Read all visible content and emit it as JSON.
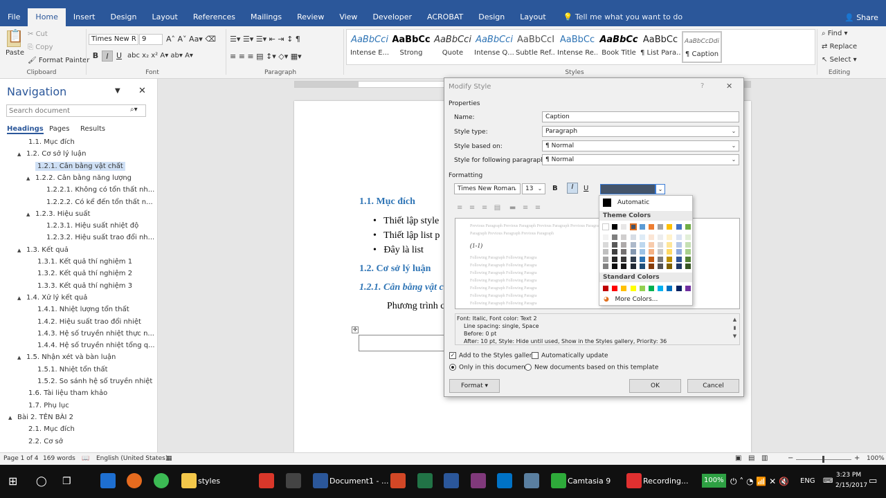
{
  "tabs": [
    "File",
    "Home",
    "Insert",
    "Design",
    "Layout",
    "References",
    "Mailings",
    "Review",
    "View",
    "Developer",
    "ACROBAT",
    "Design",
    "Layout"
  ],
  "tellme": "Tell me what you want to do",
  "share": "Share",
  "clipboard": {
    "paste": "Paste",
    "cut": "Cut",
    "copy": "Copy",
    "format_painter": "Format Painter",
    "label": "Clipboard"
  },
  "font": {
    "name": "Times New R",
    "size": "9",
    "label": "Font"
  },
  "paragraph": {
    "label": "Paragraph"
  },
  "styles": {
    "label": "Styles",
    "items": [
      {
        "preview": "AaBbCci",
        "name": "Intense E..."
      },
      {
        "preview": "AaBbCc",
        "name": "Strong"
      },
      {
        "preview": "AaBbCci",
        "name": "Quote"
      },
      {
        "preview": "AaBbCci",
        "name": "Intense Q..."
      },
      {
        "preview": "AaBbCcI",
        "name": "Subtle Ref..."
      },
      {
        "preview": "AaBbCc",
        "name": "Intense Re..."
      },
      {
        "preview": "AaBbCc",
        "name": "Book Title"
      },
      {
        "preview": "AaBbCc",
        "name": "¶ List Para..."
      },
      {
        "preview": "AaBbCcDdi",
        "name": "¶ Caption"
      }
    ]
  },
  "editing": {
    "find": "Find",
    "replace": "Replace",
    "select": "Select",
    "label": "Editing"
  },
  "nav": {
    "title": "Navigation",
    "search_placeholder": "Search document",
    "tabs": [
      "Headings",
      "Pages",
      "Results"
    ],
    "items": [
      {
        "text": "1.1. Mục đích",
        "lvl": 1,
        "tri": ""
      },
      {
        "text": "1.2. Cơ sở lý luận",
        "lvl": 1,
        "tri": "▲"
      },
      {
        "text": "1.2.1. Cân bằng vật chất",
        "lvl": 2,
        "tri": "",
        "sel": true
      },
      {
        "text": "1.2.2. Cân bằng năng lượng",
        "lvl": 2,
        "tri": "▲"
      },
      {
        "text": "1.2.2.1. Không có tổn thất nh...",
        "lvl": 3,
        "tri": ""
      },
      {
        "text": "1.2.2.2. Có kể đến tổn thất n...",
        "lvl": 3,
        "tri": ""
      },
      {
        "text": "1.2.3. Hiệu suất",
        "lvl": 2,
        "tri": "▲"
      },
      {
        "text": "1.2.3.1. Hiệu suất nhiệt độ",
        "lvl": 3,
        "tri": ""
      },
      {
        "text": "1.2.3.2. Hiệu suất trao đổi nh...",
        "lvl": 3,
        "tri": ""
      },
      {
        "text": "1.3. Kết quả",
        "lvl": 1,
        "tri": "▲"
      },
      {
        "text": "1.3.1. Kết quả thí nghiệm 1",
        "lvl": 2,
        "tri": ""
      },
      {
        "text": "1.3.2. Kết quả thí nghiệm 2",
        "lvl": 2,
        "tri": ""
      },
      {
        "text": "1.3.3. Kết quả thí nghiệm 3",
        "lvl": 2,
        "tri": ""
      },
      {
        "text": "1.4. Xử lý kết quả",
        "lvl": 1,
        "tri": "▲"
      },
      {
        "text": "1.4.1. Nhiệt lượng tổn thất",
        "lvl": 2,
        "tri": ""
      },
      {
        "text": "1.4.2. Hiệu suất trao đổi nhiệt",
        "lvl": 2,
        "tri": ""
      },
      {
        "text": "1.4.3. Hệ số truyền nhiệt thực n...",
        "lvl": 2,
        "tri": ""
      },
      {
        "text": "1.4.4. Hệ số truyền nhiệt tổng q...",
        "lvl": 2,
        "tri": ""
      },
      {
        "text": "1.5. Nhận xét và bàn luận",
        "lvl": 1,
        "tri": "▲"
      },
      {
        "text": "1.5.1. Nhiệt tổn thất",
        "lvl": 2,
        "tri": ""
      },
      {
        "text": "1.5.2. So sánh hệ số truyền nhiệt",
        "lvl": 2,
        "tri": ""
      },
      {
        "text": "1.6. Tài liệu tham khảo",
        "lvl": 1,
        "tri": ""
      },
      {
        "text": "1.7. Phụ lục",
        "lvl": 1,
        "tri": ""
      },
      {
        "text": "Bài 2. TÊN BÀI 2",
        "lvl": 0,
        "tri": "▲"
      },
      {
        "text": "2.1. Mục đích",
        "lvl": 1,
        "tri": ""
      },
      {
        "text": "2.2. Cơ sở",
        "lvl": 1,
        "tri": ""
      }
    ]
  },
  "doc": {
    "h1": "1.1. Mục đích",
    "bullets": [
      "Thiết lập style",
      "Thiết lập list p",
      "Đây là list"
    ],
    "h2": "1.2. Cơ sở lý luận",
    "h3": "1.2.1. Cân bằng vật c",
    "body": "Phương trình c"
  },
  "dialog": {
    "title": "Modify Style",
    "help": "?",
    "close": "✕",
    "properties_label": "Properties",
    "name_label": "Name:",
    "name_value": "Caption",
    "type_label": "Style type:",
    "type_value": "Paragraph",
    "based_label": "Style based on:",
    "based_value": "¶ Normal",
    "following_label": "Style for following paragraph:",
    "following_value": "¶ Normal",
    "formatting_label": "Formatting",
    "font_value": "Times New Roman",
    "size_value": "13",
    "preview_prev": "Previous Paragraph Previous Paragraph Previous Paragraph Previous Paragraph Previous Paragraph Previous Paragraph Previous Paragraph Previous Paragraph Previous Paragraph",
    "preview_sample": "(1-1)",
    "preview_follow": "Following Paragraph Following Paragra",
    "desc_line1": "Font: Italic, Font color: Text 2",
    "desc_line2": "Line spacing:  single, Space",
    "desc_line3": "Before:  0 pt",
    "desc_line4": "After:  10 pt, Style: Hide until used, Show in the Styles gallery, Priority: 36",
    "add_gallery": "Add to the Styles gallery",
    "auto_update": "Automatically update",
    "only_doc": "Only in this document",
    "new_docs": "New documents based on this template",
    "format_btn": "Format ▾",
    "ok": "OK",
    "cancel": "Cancel"
  },
  "palette": {
    "automatic": "Automatic",
    "theme_label": "Theme Colors",
    "standard_label": "Standard Colors",
    "more": "More Colors...",
    "theme_top": [
      "#ffffff",
      "#000000",
      "#e7e6e6",
      "#44546a",
      "#5b9bd5",
      "#ed7d31",
      "#a5a5a5",
      "#ffc000",
      "#4472c4",
      "#70ad47"
    ],
    "theme_cols": [
      [
        "#f2f2f2",
        "#d9d9d9",
        "#bfbfbf",
        "#a6a6a6",
        "#808080"
      ],
      [
        "#7f7f7f",
        "#595959",
        "#404040",
        "#262626",
        "#0d0d0d"
      ],
      [
        "#d0cece",
        "#aeaaaa",
        "#757171",
        "#3a3838",
        "#171616"
      ],
      [
        "#d6dce4",
        "#adb9ca",
        "#8497b0",
        "#333f4f",
        "#222a35"
      ],
      [
        "#deebf6",
        "#bdd7ee",
        "#9dc3e6",
        "#2e75b5",
        "#1f4e79"
      ],
      [
        "#fbe5d5",
        "#f7cbac",
        "#f4b183",
        "#c55a11",
        "#843c0b"
      ],
      [
        "#ededed",
        "#dbdbdb",
        "#c9c9c9",
        "#7b7b7b",
        "#525252"
      ],
      [
        "#fff2cc",
        "#fee599",
        "#ffd965",
        "#bf9000",
        "#7f6000"
      ],
      [
        "#dae3f3",
        "#b4c7e7",
        "#8faadc",
        "#2f5496",
        "#1f3864"
      ],
      [
        "#e2efd9",
        "#c5e0b3",
        "#a8d08d",
        "#538135",
        "#375623"
      ]
    ],
    "standard": [
      "#c00000",
      "#ff0000",
      "#ffc000",
      "#ffff00",
      "#92d050",
      "#00b050",
      "#00b0f0",
      "#0070c0",
      "#002060",
      "#7030a0"
    ]
  },
  "status": {
    "page": "Page 1 of 4",
    "words": "169 words",
    "lang": "English (United States)",
    "zoom": "100%"
  },
  "taskbar": {
    "styles": "styles",
    "doc": "Document1 - ...",
    "camtasia": "Camtasia 9",
    "recording": "Recording...",
    "battery": "100%",
    "lang": "ENG",
    "time": "3:23 PM",
    "date": "2/15/2017"
  }
}
